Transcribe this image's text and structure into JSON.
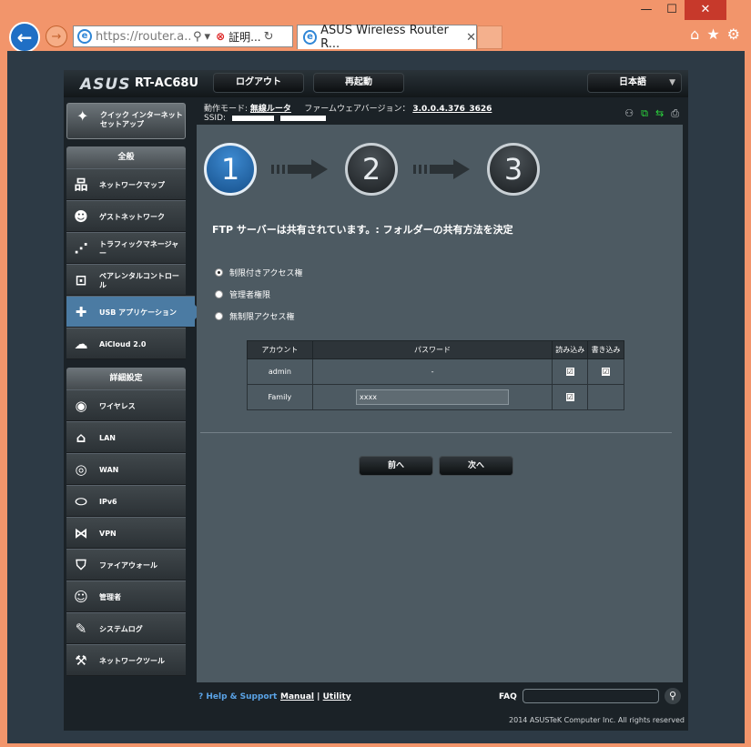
{
  "browser": {
    "url": "https://router.a...",
    "cert_label": "証明...",
    "tab_title": "ASUS Wireless Router R...",
    "tab_close": "✕",
    "win_min": "—",
    "win_max": "☐",
    "win_close": "✕",
    "back": "←",
    "forward": "→",
    "search_glyph": "⚲",
    "dropdown_glyph": "▾",
    "cert_glyph": "⊗",
    "refresh_glyph": "↻",
    "home_glyph": "⌂",
    "fav_glyph": "★",
    "settings_glyph": "⚙"
  },
  "router": {
    "brand": "ASUS",
    "model": "RT-AC68U",
    "logout": "ログアウト",
    "reboot": "再起動",
    "language": "日本語",
    "language_caret": "▼",
    "status": {
      "op_mode_label": "動作モード:",
      "op_mode_value": "無線ルータ",
      "fw_label": "ファームウェアバージョン：",
      "fw_value": "3.0.0.4.376_3626",
      "ssid_label": "SSID:"
    },
    "status_icons": {
      "clients": "⚇",
      "network": "⧉",
      "usb": "⇆",
      "printer": "⎙"
    },
    "qis": {
      "icon": "✦",
      "label": "クイック インターネット セットアップ"
    },
    "general_header": "全般",
    "general_items": [
      {
        "icon": "品",
        "label": "ネットワークマップ"
      },
      {
        "icon": "☻",
        "label": "ゲストネットワーク"
      },
      {
        "icon": "⋰",
        "label": "トラフィックマネージャー"
      },
      {
        "icon": "⊡",
        "label": "ペアレンタルコントロール"
      },
      {
        "icon": "✚",
        "label": "USB アプリケーション"
      },
      {
        "icon": "☁",
        "label": "AiCloud 2.0"
      }
    ],
    "advanced_header": "詳細設定",
    "advanced_items": [
      {
        "icon": "◉",
        "label": "ワイヤレス"
      },
      {
        "icon": "⌂",
        "label": "LAN"
      },
      {
        "icon": "◎",
        "label": "WAN"
      },
      {
        "icon": "⬭",
        "label": "IPv6"
      },
      {
        "icon": "⋈",
        "label": "VPN"
      },
      {
        "icon": "⛉",
        "label": "ファイアウォール"
      },
      {
        "icon": "☺",
        "label": "管理者"
      },
      {
        "icon": "✎",
        "label": "システムログ"
      },
      {
        "icon": "⚒",
        "label": "ネットワークツール"
      }
    ]
  },
  "wizard": {
    "steps": [
      "1",
      "2",
      "3"
    ],
    "question": "FTP サーバーは共有されています。: フォルダーの共有方法を決定",
    "options": [
      "制限付きアクセス権",
      "管理者権限",
      "無制限アクセス権"
    ],
    "selected_option": 0,
    "table": {
      "headers": [
        "アカウント",
        "パスワード",
        "読み込み",
        "書き込み"
      ],
      "rows": [
        {
          "account": "admin",
          "password": "-",
          "read": "☑",
          "write": "☑"
        },
        {
          "account": "Family",
          "password": "xxxx",
          "read": "☑",
          "write": ""
        }
      ]
    },
    "prev": "前へ",
    "next": "次へ"
  },
  "footer": {
    "help": "Help & Support",
    "manual": "Manual",
    "separator": "|",
    "utility": "Utility",
    "faq": "FAQ",
    "faq_go": "⚲",
    "copyright": "2014 ASUSTeK Computer Inc. All rights reserved"
  },
  "colors": {
    "browser_frame": "#f2956b",
    "page_bg": "#2d3a45",
    "content_bg": "#4d5a62",
    "active_nav": "#4b7ba3",
    "accent_blue": "#5aa3e6"
  }
}
